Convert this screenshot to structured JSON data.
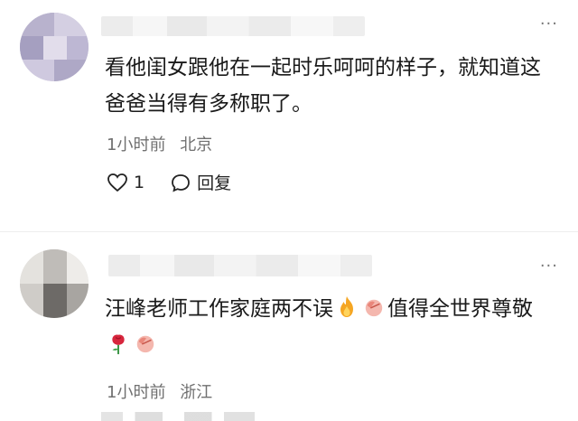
{
  "comments": [
    {
      "text": "看他闺女跟他在一起时乐呵呵的样子，就知道这爸爸当得有多称职了。",
      "time": "1小时前",
      "location": "北京",
      "likes": "1",
      "reply_label": "回复"
    },
    {
      "text_part1": "汪峰老师工作家庭两不误",
      "text_part2": "值得全世界尊敬",
      "time": "1小时前",
      "location": "浙江"
    }
  ],
  "icons": {
    "more": "more-dots-icon",
    "like": "heart-icon",
    "reply": "comment-bubble-icon",
    "fire": "fire-emoji-icon",
    "bow": "bow-emoji-icon",
    "rose": "rose-emoji-icon"
  },
  "colors": {
    "text": "#1a1a1a",
    "meta": "#707070",
    "avatar1": "#c8c3da",
    "avatar2": "#d9d7d4"
  }
}
